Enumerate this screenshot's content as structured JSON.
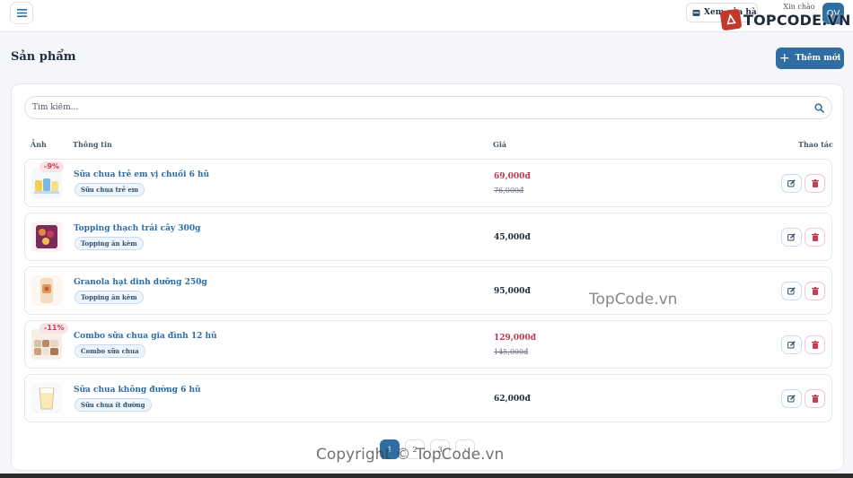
{
  "header": {
    "view_store_label": "Xem cửa hàng",
    "greeting": "Xin chào",
    "avatar_initials": "QV",
    "watermark_logo": "TOPCODE.VN"
  },
  "page": {
    "title": "Sản phẩm",
    "add_label": "Thêm mới"
  },
  "search": {
    "placeholder": "Tìm kiếm..."
  },
  "table": {
    "columns": [
      "Ảnh",
      "Thông tin",
      "Giá",
      "Thao tác"
    ],
    "rows": [
      {
        "name": "Sữa chua trẻ em vị chuối 6 hũ",
        "category": "Sữa chua trẻ em",
        "price": "69,000đ",
        "old_price": "76,000đ",
        "discount": "-9%"
      },
      {
        "name": "Topping thạch trái cây 300g",
        "category": "Topping ăn kèm",
        "price": "45,000đ"
      },
      {
        "name": "Granola hạt dinh dưỡng 250g",
        "category": "Topping ăn kèm",
        "price": "95,000đ"
      },
      {
        "name": "Combo sữa chua gia đình 12 hũ",
        "category": "Combo sữa chua",
        "price": "129,000đ",
        "old_price": "145,000đ",
        "discount": "-11%"
      },
      {
        "name": "Sữa chua không đường 6 hũ",
        "category": "Sữa chua ít đường",
        "price": "62,000đ"
      }
    ]
  },
  "pagination": {
    "pages": [
      "1",
      "2",
      "3",
      "›"
    ],
    "current": "1"
  },
  "watermarks": {
    "middle": "TopCode.vn",
    "bottom": "Copyright © TopCode.vn"
  },
  "colors": {
    "accent": "#2f6da3",
    "sale": "#b83a52",
    "delete": "#c43d55"
  }
}
